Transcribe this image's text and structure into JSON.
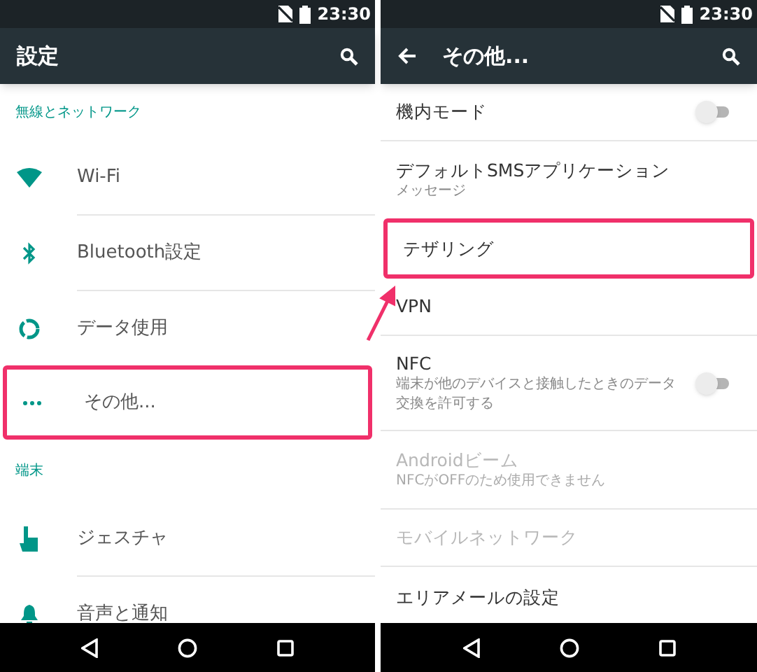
{
  "screens": [
    {
      "status_bar": {
        "time": "23:30"
      },
      "toolbar": {
        "title": "設定",
        "back": false
      },
      "items": [
        {
          "kind": "section",
          "label": "無線とネットワーク"
        },
        {
          "kind": "item",
          "label": "Wi-Fi",
          "highlighted": false
        },
        {
          "kind": "item",
          "label": "Bluetooth設定",
          "highlighted": false
        },
        {
          "kind": "item",
          "label": "データ使用",
          "highlighted": false
        },
        {
          "kind": "item",
          "label": "その他...",
          "highlighted": true
        },
        {
          "kind": "section",
          "label": "端末"
        },
        {
          "kind": "item",
          "label": "ジェスチャ",
          "highlighted": false
        },
        {
          "kind": "item",
          "label": "音声と通知",
          "highlighted": false
        }
      ]
    },
    {
      "status_bar": {
        "time": "23:30"
      },
      "toolbar": {
        "title": "その他...",
        "back": true
      },
      "items": [
        {
          "kind": "setting",
          "label": "機内モード",
          "toggle": {
            "on": false
          },
          "disabled": false,
          "highlighted": false
        },
        {
          "kind": "setting",
          "label": "デフォルトSMSアプリケーション",
          "sublabel": "メッセージ",
          "disabled": false,
          "highlighted": false
        },
        {
          "kind": "setting",
          "label": "テザリング",
          "disabled": false,
          "highlighted": true
        },
        {
          "kind": "setting",
          "label": "VPN",
          "disabled": false,
          "highlighted": false
        },
        {
          "kind": "setting",
          "label": "NFC",
          "sublabel": "端末が他のデバイスと接触したときのデータ交換を許可する",
          "toggle": {
            "on": false
          },
          "disabled": false,
          "highlighted": false
        },
        {
          "kind": "setting",
          "label": "Androidビーム",
          "sublabel": "NFCがOFFのため使用できません",
          "disabled": true,
          "highlighted": false
        },
        {
          "kind": "setting",
          "label": "モバイルネットワーク",
          "disabled": true,
          "highlighted": false
        },
        {
          "kind": "setting",
          "label": "エリアメールの設定",
          "disabled": false,
          "highlighted": false
        }
      ]
    }
  ]
}
